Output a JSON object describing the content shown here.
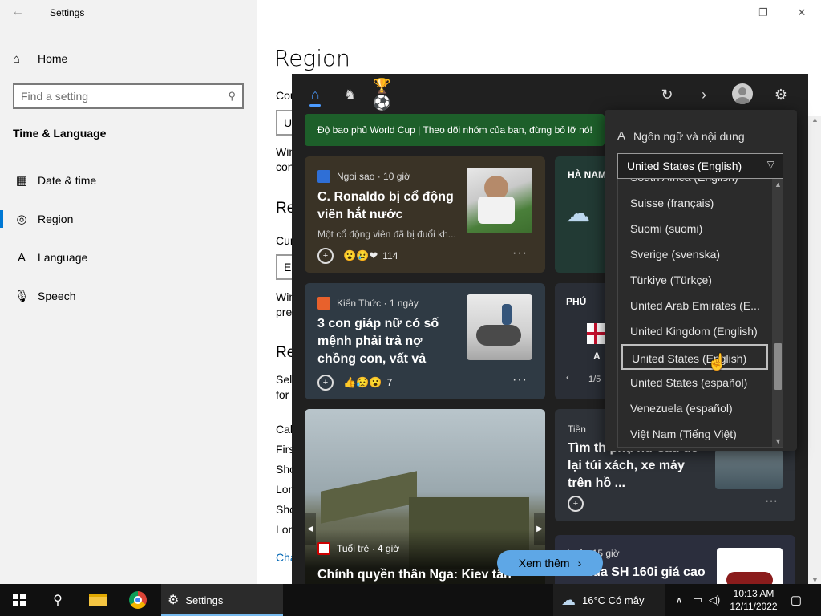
{
  "window": {
    "title": "Settings"
  },
  "sidebar": {
    "home": "Home",
    "search_placeholder": "Find a setting",
    "section": "Time & Language",
    "items": [
      {
        "label": "Date & time",
        "icon": "calendar-clock-icon"
      },
      {
        "label": "Region",
        "icon": "globe-icon"
      },
      {
        "label": "Language",
        "icon": "language-icon"
      },
      {
        "label": "Speech",
        "icon": "microphone-icon"
      }
    ]
  },
  "main": {
    "title": "Region",
    "partials": [
      "Cou",
      "U",
      "Win",
      "con",
      "Re",
      "Cur",
      "E",
      "Win",
      "pre",
      "Re",
      "Sel",
      "for",
      "Cal",
      "Firs",
      "Sho",
      "Lon",
      "Sho",
      "Lon",
      "Cha"
    ]
  },
  "news": {
    "banner": "Độ bao phủ World Cup | Theo dõi nhóm của bạn, đừng bỏ lỡ nó!",
    "cards": [
      {
        "source": "Ngoi sao · 10 giờ",
        "headline": "C. Ronaldo bị cổ động viên hắt nước",
        "snippet": "Một cổ động viên đã bị đuổi kh...",
        "reaction_count": "114"
      },
      {
        "source": "Kiến Thức · 1 ngày",
        "headline": "3 con giáp nữ có số mệnh phải trả nợ chồng con, vất vả",
        "snippet": "",
        "reaction_count": "7"
      },
      {
        "source": "Tuổi trẻ · 4 giờ",
        "headline": "Chính quyền thân Nga: Kiev tấn",
        "snippet": "",
        "reaction_count": ""
      }
    ],
    "right_cards": [
      {
        "text": "HÀ NAM"
      },
      {
        "text": "PHÚ",
        "pager": "1/5",
        "sub": "A"
      },
      {
        "source": "Tiền",
        "headline": "Tìm th phụ nữ sau để lại túi xách, xe máy trên hồ ..."
      },
      {
        "source": "i trẻ · 15 giờ",
        "headline": "Honda SH 160i giá cao"
      }
    ],
    "see_more": "Xem thêm"
  },
  "flyout": {
    "title": "Ngôn ngữ và nội dung",
    "selected": "United States (English)",
    "options": [
      "South Africa (English)",
      "Suisse (français)",
      "Suomi (suomi)",
      "Sverige (svenska)",
      "Türkiye (Türkçe)",
      "United Arab Emirates (E...",
      "United Kingdom (English)",
      "United States (English)",
      "United States (español)",
      "Venezuela (español)",
      "Việt Nam (Tiếng Việt)"
    ]
  },
  "taskbar": {
    "app": "Settings",
    "weather": "16°C  Có mây",
    "time": "10:13 AM",
    "date": "12/11/2022"
  },
  "colors": {
    "accent": "#0078d4",
    "news_bg": "#202020",
    "banner": "#1d5f2a",
    "see_more": "#5ea7e6"
  }
}
